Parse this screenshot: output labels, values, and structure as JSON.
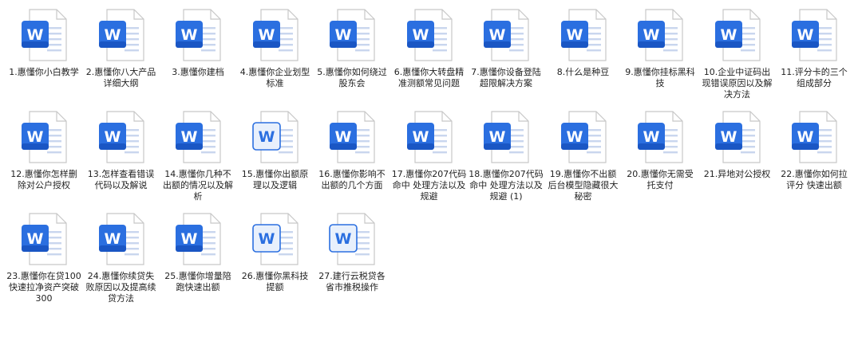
{
  "files": [
    {
      "name": "1.惠懂你小白教学",
      "style": "filled"
    },
    {
      "name": "2.惠懂你八大产品详细大纲",
      "style": "filled"
    },
    {
      "name": "3.惠懂你建档",
      "style": "filled"
    },
    {
      "name": "4.惠懂你企业划型标准",
      "style": "filled"
    },
    {
      "name": "5.惠懂你如何绕过股东会",
      "style": "filled"
    },
    {
      "name": "6.惠懂你大转盘精准测额常见问题",
      "style": "filled"
    },
    {
      "name": "7.惠懂你设备登陆超限解决方案",
      "style": "filled"
    },
    {
      "name": "8.什么是种豆",
      "style": "filled"
    },
    {
      "name": "9.惠懂你挂标黑科技",
      "style": "filled"
    },
    {
      "name": "10.企业中证码出现错误原因以及解决方法",
      "style": "filled"
    },
    {
      "name": "11.评分卡的三个组成部分",
      "style": "filled"
    },
    {
      "name": "12.惠懂你怎样删除对公户授权",
      "style": "filled"
    },
    {
      "name": "13.怎样查看错误代码以及解说",
      "style": "filled"
    },
    {
      "name": "14.惠懂你几种不出额的情况以及解析",
      "style": "filled"
    },
    {
      "name": "15.惠懂你出额原理以及逻辑",
      "style": "outline"
    },
    {
      "name": "16.惠懂你影响不出额的几个方面",
      "style": "filled"
    },
    {
      "name": "17.惠懂你207代码命中 处理方法以及规避",
      "style": "filled"
    },
    {
      "name": "18.惠懂你207代码命中 处理方法以及规避 (1)",
      "style": "filled"
    },
    {
      "name": "19.惠懂你不出额后台模型隐藏很大秘密",
      "style": "filled"
    },
    {
      "name": "20.惠懂你无需受托支付",
      "style": "filled"
    },
    {
      "name": "21.异地对公授权",
      "style": "filled"
    },
    {
      "name": "22.惠懂你如何拉评分 快速出额",
      "style": "filled"
    },
    {
      "name": "23.惠懂你在贷100 快速拉净资产突破300",
      "style": "filled"
    },
    {
      "name": "24.惠懂你续贷失败原因以及提高续贷方法",
      "style": "filled"
    },
    {
      "name": "25.惠懂你增量陪跑快速出额",
      "style": "filled"
    },
    {
      "name": "26.惠懂你黑科技提额",
      "style": "outline"
    },
    {
      "name": "27.建行云税贷各省市推税操作",
      "style": "outline"
    }
  ],
  "icon_letter": "W",
  "colors": {
    "word_blue": "#2b6fe0",
    "word_blue_dark": "#1a56c4",
    "page_fill": "#ffffff",
    "page_border": "#c8c8c8",
    "outline_bg": "#e8f0fc",
    "text": "#222222"
  }
}
